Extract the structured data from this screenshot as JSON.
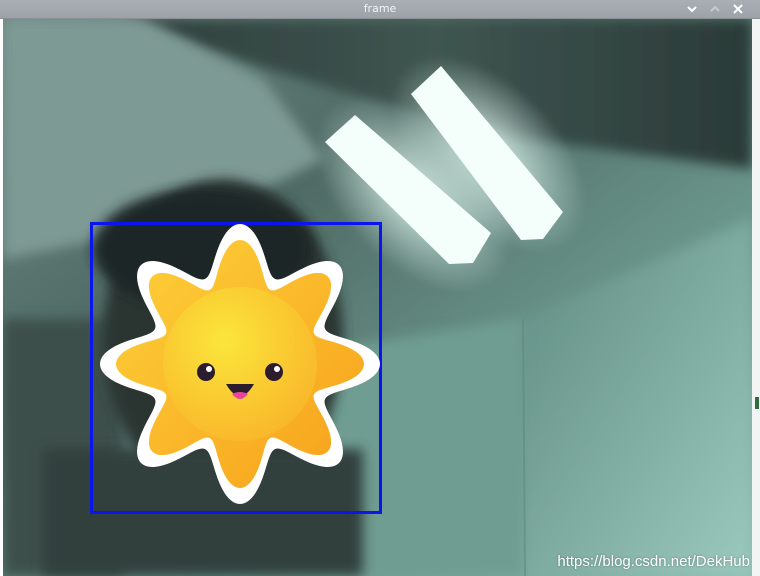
{
  "window": {
    "title": "frame"
  },
  "titlebar_buttons": {
    "minimize_icon": "chevron-down-icon",
    "maximize_icon": "chevron-up-icon",
    "close_icon": "close-icon"
  },
  "overlay": {
    "detection_box_color": "#0b16ee",
    "sun_emoji_icon": "smiling-sun-icon"
  },
  "watermark": {
    "text": "https://blog.csdn.net/DekHub"
  }
}
